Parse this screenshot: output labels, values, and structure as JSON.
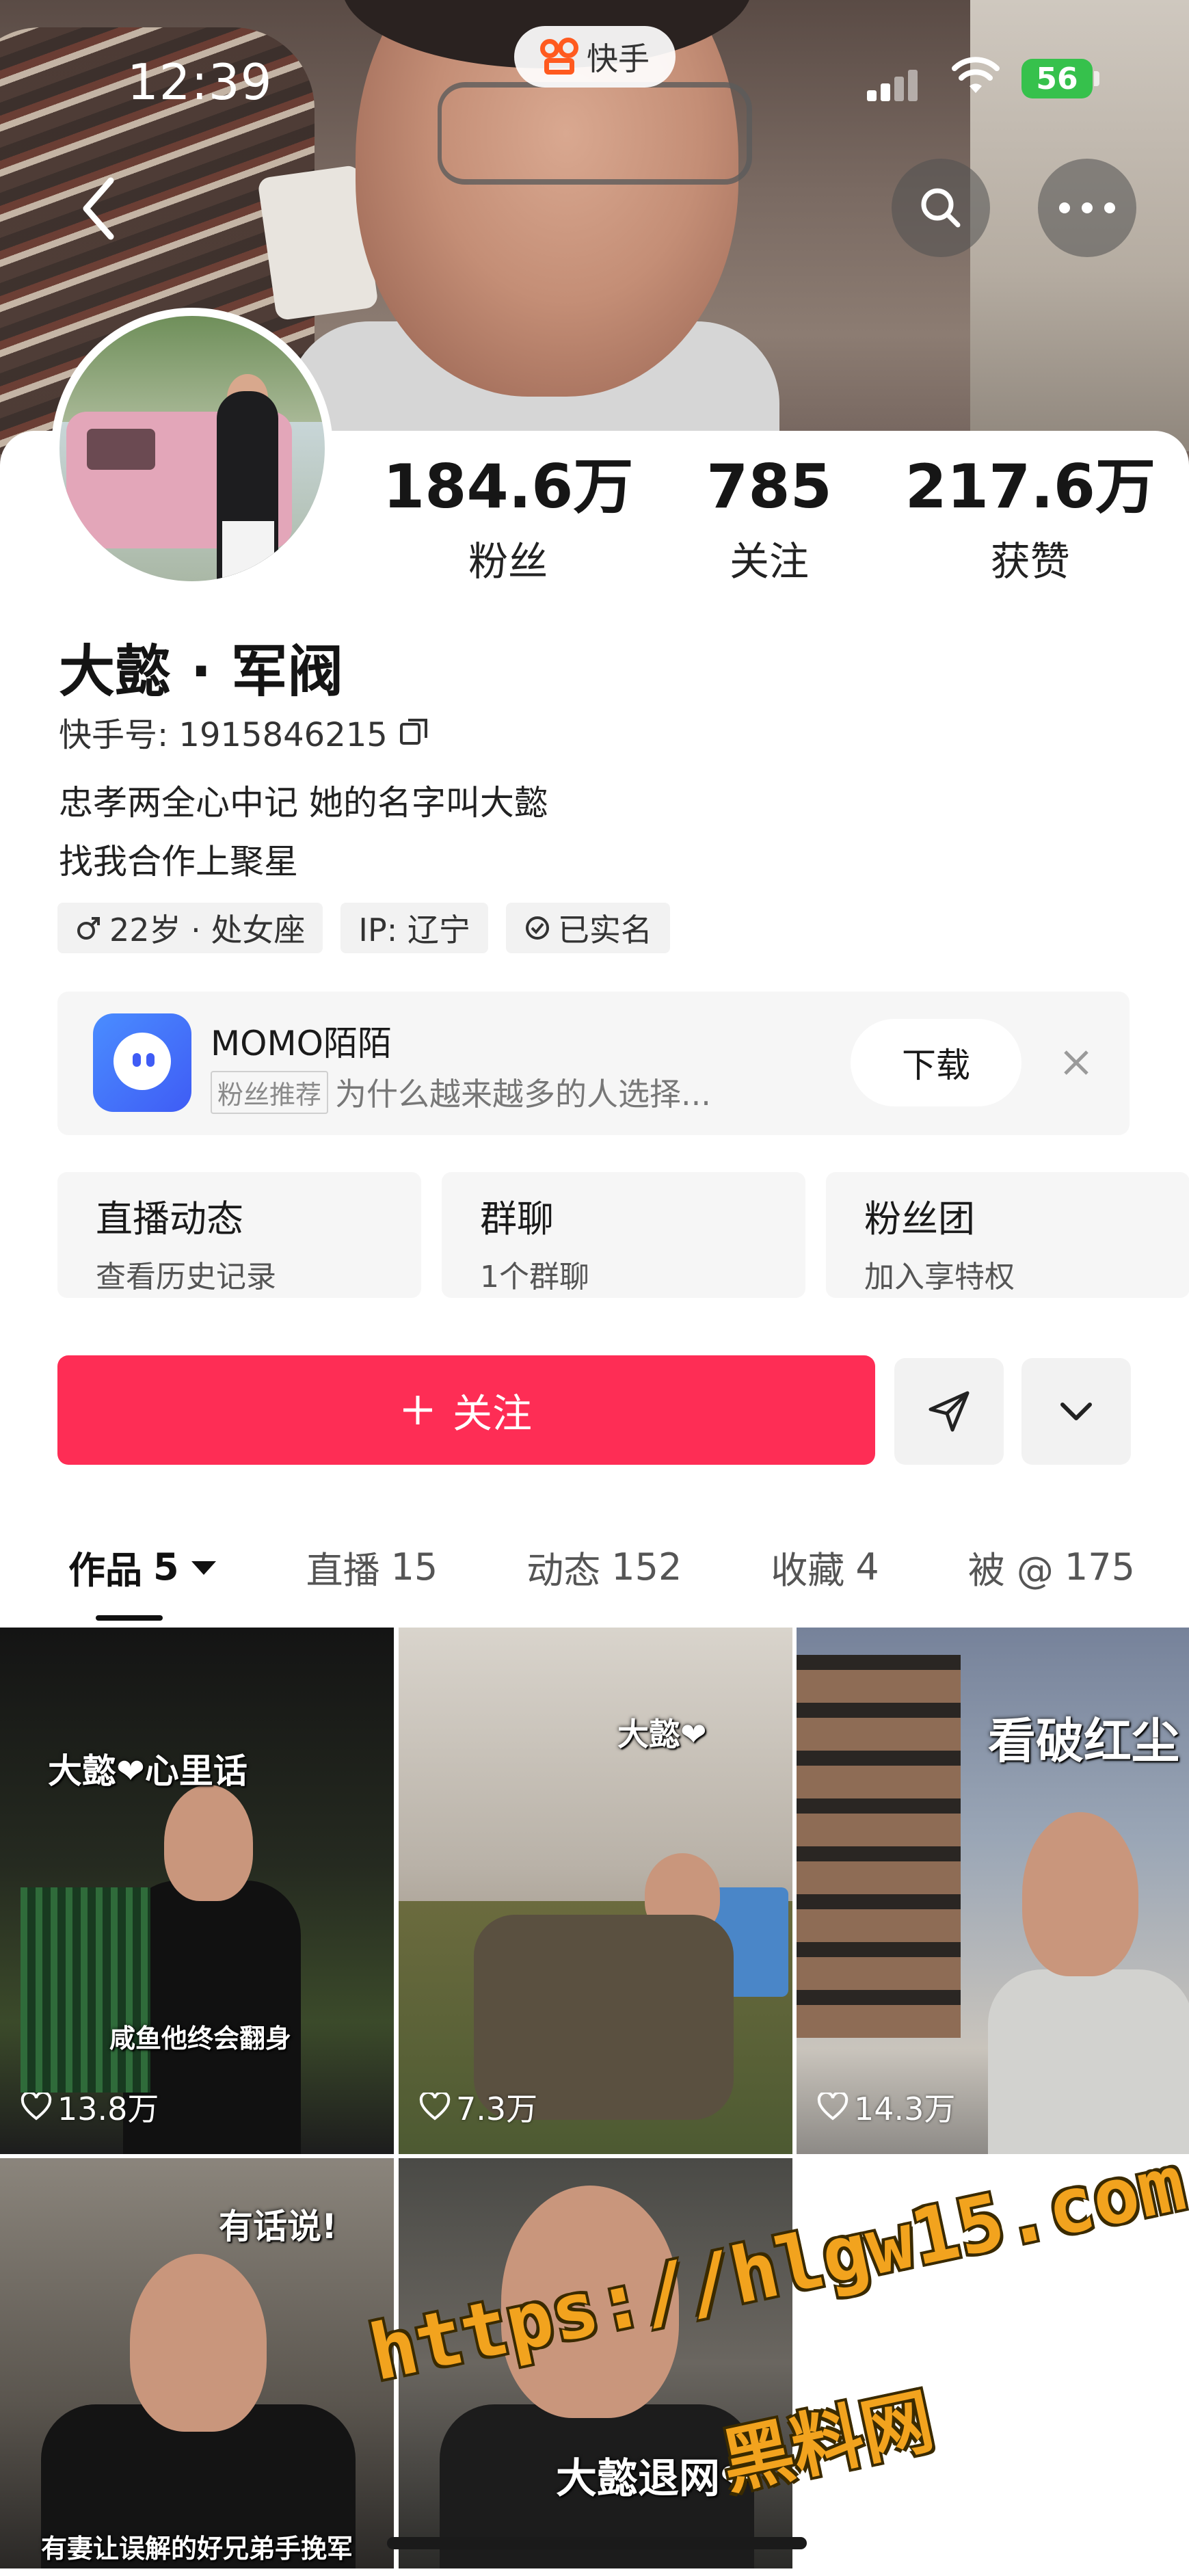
{
  "status_bar": {
    "time": "12:39",
    "battery": "56",
    "app_name": "快手"
  },
  "profile": {
    "name": "大懿 · 军阀",
    "uid": "快手号: 1915846215",
    "bio": [
      "忠孝两全心中记 她的名字叫大懿",
      "找我合作上聚星"
    ],
    "tags": [
      "22岁 · 处女座",
      "IP: 辽宁",
      "已实名"
    ]
  },
  "stats": [
    {
      "value": "184.6万",
      "label": "粉丝"
    },
    {
      "value": "785",
      "label": "关注"
    },
    {
      "value": "217.6万",
      "label": "获赞"
    }
  ],
  "ad": {
    "title": "MOMO陌陌",
    "badge": "粉丝推荐",
    "subtitle": "为什么越来越多的人选择...",
    "button": "下载"
  },
  "features": [
    {
      "title": "直播动态",
      "subtitle": "查看历史记录"
    },
    {
      "title": "群聊",
      "subtitle": "1个群聊"
    },
    {
      "title": "粉丝团",
      "subtitle": "加入享特权"
    }
  ],
  "actions": {
    "follow": "关注"
  },
  "tabs": [
    {
      "label": "作品",
      "count": "5"
    },
    {
      "label": "直播",
      "count": "15"
    },
    {
      "label": "动态",
      "count": "152"
    },
    {
      "label": "收藏",
      "count": "4"
    },
    {
      "label": "被 @",
      "count": "175"
    }
  ],
  "videos": [
    {
      "caption": "大懿❤心里话",
      "subcaption": "咸鱼他终会翻身",
      "likes": "13.8万"
    },
    {
      "caption": "大懿❤",
      "likes": "7.3万"
    },
    {
      "caption": "看破红尘",
      "likes": "14.3万"
    },
    {
      "caption": "有话说!",
      "subcaption": "有妻让误解的好兄弟手挽军"
    },
    {
      "caption": "大懿退网❤"
    }
  ],
  "watermark": {
    "url": "https://hlgw15.com",
    "text": "黑料网"
  },
  "colors": {
    "follow": "#fe2d55",
    "accent_logo": "#ff5a1f",
    "battery": "#36c14c"
  }
}
